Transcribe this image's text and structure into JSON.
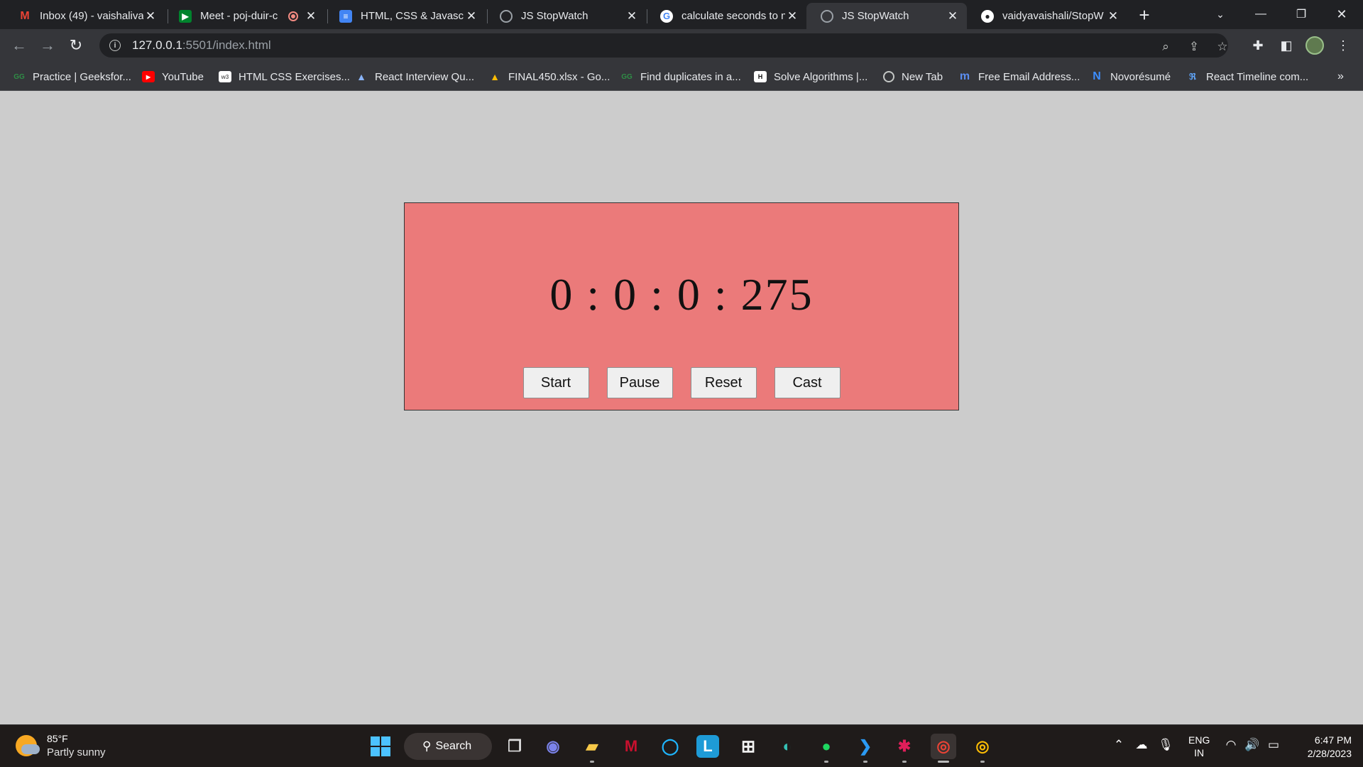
{
  "browser": {
    "tabs": [
      {
        "title": "Inbox (49) - vaishaliva",
        "favicon": "gmail-icon",
        "active": false
      },
      {
        "title": "Meet - poj-duir-c",
        "favicon": "google-meet-icon",
        "active": false,
        "recording": true
      },
      {
        "title": "HTML, CSS & Javascri",
        "favicon": "google-docs-icon",
        "active": false
      },
      {
        "title": "JS StopWatch",
        "favicon": "globe-icon",
        "active": false
      },
      {
        "title": "calculate seconds to n",
        "favicon": "google-icon",
        "active": false
      },
      {
        "title": "JS StopWatch",
        "favicon": "globe-icon",
        "active": true
      },
      {
        "title": "vaidyavaishali/StopW",
        "favicon": "github-icon",
        "active": false
      }
    ],
    "url_host": "127.0.0.1",
    "url_path": ":5501/index.html",
    "bookmarks": [
      {
        "label": "Practice | Geeksfor...",
        "icon": "geeksforgeeks-icon"
      },
      {
        "label": "YouTube",
        "icon": "youtube-icon"
      },
      {
        "label": "HTML CSS Exercises...",
        "icon": "w3resource-icon"
      },
      {
        "label": "React Interview Qu...",
        "icon": "mountain-icon"
      },
      {
        "label": "FINAL450.xlsx - Go...",
        "icon": "google-drive-icon"
      },
      {
        "label": "Find duplicates in a...",
        "icon": "geeksforgeeks-icon"
      },
      {
        "label": "Solve Algorithms |...",
        "icon": "hackerrank-icon"
      },
      {
        "label": "New Tab",
        "icon": "globe-icon"
      },
      {
        "label": "Free Email Address...",
        "icon": "m-icon"
      },
      {
        "label": "Novorésumé",
        "icon": "novoresume-icon"
      },
      {
        "label": "React Timeline com...",
        "icon": "react-timeline-icon"
      }
    ],
    "more_bookmarks": "»"
  },
  "stopwatch": {
    "time_display": "0 : 0 : 0 : 275",
    "buttons": {
      "start": "Start",
      "pause": "Pause",
      "reset": "Reset",
      "cast": "Cast"
    },
    "panel_color": "#eb7a7a",
    "page_background": "#cccccc"
  },
  "taskbar": {
    "weather_temp": "85°F",
    "weather_desc": "Partly sunny",
    "search_label": "Search",
    "lang_line1": "ENG",
    "lang_line2": "IN",
    "time": "6:47 PM",
    "date": "2/28/2023"
  }
}
